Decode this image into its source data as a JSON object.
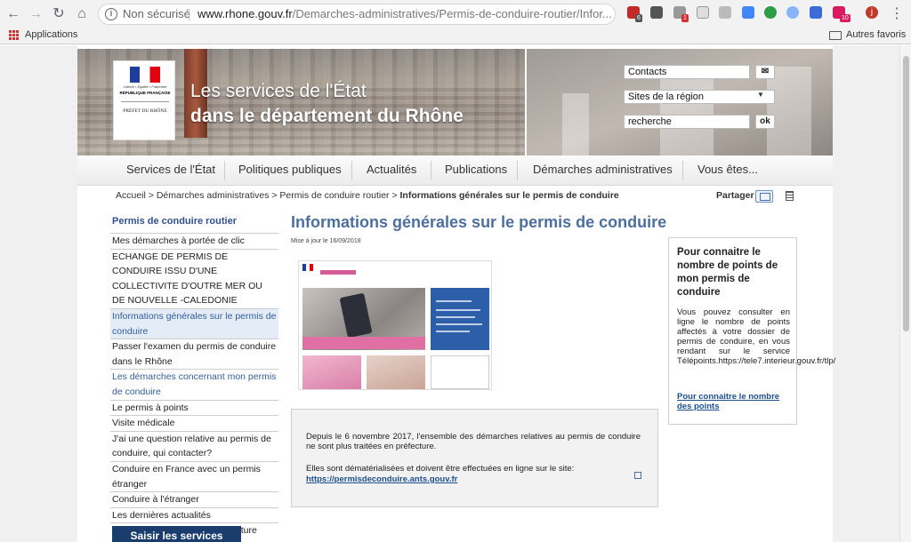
{
  "browser": {
    "security_label": "Non sécurisé",
    "url_host": "www.rhone.gouv.fr",
    "url_path": "/Demarches-administratives/Permis-de-conduire-routier/Infor...",
    "ext_badges": [
      "6",
      "1",
      "10"
    ],
    "profile_initial": "j",
    "bookmarks": {
      "apps": "Applications",
      "other": "Autres favoris"
    }
  },
  "header": {
    "logo": {
      "motto": "Liberté • Égalité • Fraternité",
      "republic": "RÉPUBLIQUE FRANÇAISE",
      "prefect": "PRÉFET DU RHÔNE"
    },
    "title_line1": "Les services de l'État",
    "title_line2": "dans le département du Rhône",
    "contacts": "Contacts",
    "sites_select": "Sites de la région",
    "search_value": "recherche",
    "ok_label": "ok"
  },
  "nav": [
    "Services de l'État",
    "Politiques publiques",
    "Actualités",
    "Publications",
    "Démarches administratives",
    "Vous êtes..."
  ],
  "breadcrumb": {
    "path": "Accueil > Démarches administratives > Permis de conduire routier > ",
    "current": "Informations générales sur le permis de conduire"
  },
  "share_label": "Partager",
  "sidebar": {
    "title": "Permis de conduire routier",
    "items": [
      "Mes démarches à portée de clic",
      "ECHANGE DE PERMIS DE CONDUIRE ISSU D'UNE COLLECTIVITE D'OUTRE MER OU DE NOUVELLE -CALEDONIE",
      "Informations générales sur le permis de conduire",
      "Passer l'examen du permis de conduire dans le Rhône",
      "Les démarches concernant mon permis de conduire",
      "Le permis à points",
      "Visite médicale",
      "J'ai une question relative au permis de conduire, qui contacter?",
      "Conduire en France avec un permis étranger",
      "Conduire à l'étranger",
      "Les dernières actualités",
      "Prendre rendez-vous en préfecture"
    ],
    "join_button": "Saisir les services"
  },
  "main": {
    "title": "Informations générales sur le permis de conduire",
    "updated": "Mise à jour le 16/09/2018",
    "notice_p1": "Depuis le 6 novembre 2017, l'ensemble des démarches relatives au permis de conduire ne sont plus traitées en préfecture.",
    "notice_p2": "Elles sont dématérialisées et doivent être effectuées en ligne sur le site:",
    "notice_link": "https://permisdeconduire.ants.gouv.fr"
  },
  "aside": {
    "title": "Pour connaitre le nombre de points de mon permis de conduire",
    "body": "Vous pouvez consulter en ligne le nombre de points affectés à votre dossier de permis de conduire, en vous rendant sur le service Télépoints.https://tele7.interieur.gouv.fr/tlp/",
    "link": "Pour connaitre le nombre des points"
  }
}
